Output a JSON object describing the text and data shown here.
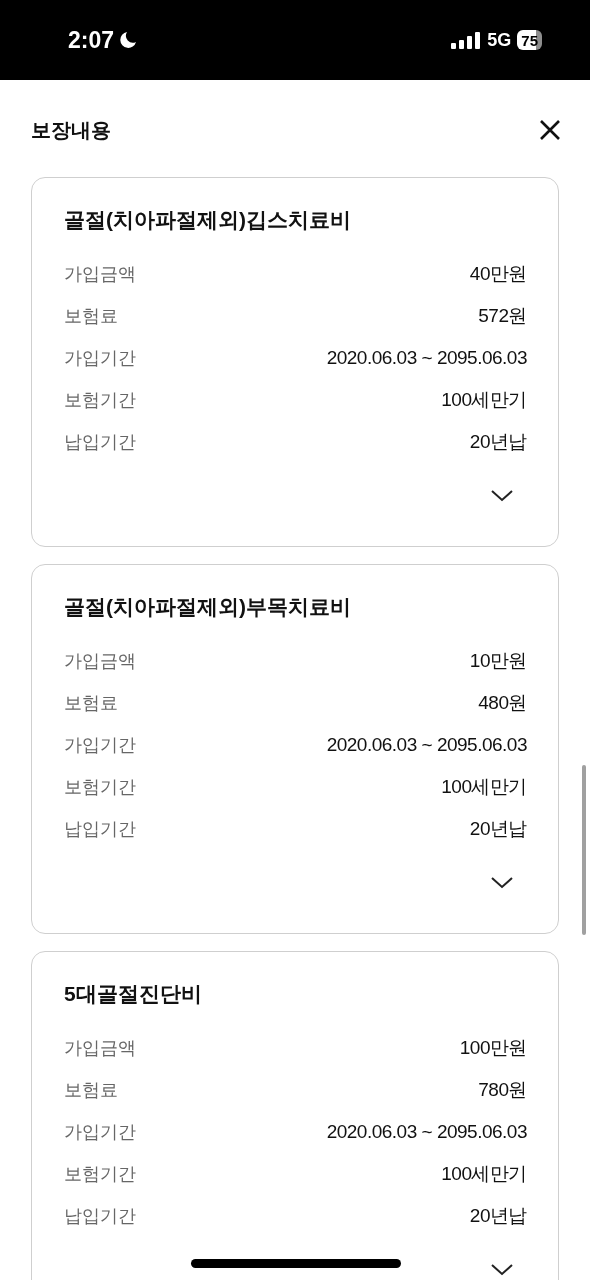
{
  "status_bar": {
    "time": "2:07",
    "network": "5G",
    "battery": "75"
  },
  "header": {
    "title": "보장내용"
  },
  "coverages": [
    {
      "title": "골절(치아파절제외)깁스치료비",
      "expanded": false,
      "rows": [
        {
          "label": "가입금액",
          "value": "40만원"
        },
        {
          "label": "보험료",
          "value": "572원"
        },
        {
          "label": "가입기간",
          "value": "2020.06.03 ~ 2095.06.03"
        },
        {
          "label": "보험기간",
          "value": "100세만기"
        },
        {
          "label": "납입기간",
          "value": "20년납"
        }
      ]
    },
    {
      "title": "골절(치아파절제외)부목치료비",
      "expanded": false,
      "rows": [
        {
          "label": "가입금액",
          "value": "10만원"
        },
        {
          "label": "보험료",
          "value": "480원"
        },
        {
          "label": "가입기간",
          "value": "2020.06.03 ~ 2095.06.03"
        },
        {
          "label": "보험기간",
          "value": "100세만기"
        },
        {
          "label": "납입기간",
          "value": "20년납"
        }
      ]
    },
    {
      "title": "5대골절진단비",
      "expanded": false,
      "rows": [
        {
          "label": "가입금액",
          "value": "100만원"
        },
        {
          "label": "보험료",
          "value": "780원"
        },
        {
          "label": "가입기간",
          "value": "2020.06.03 ~ 2095.06.03"
        },
        {
          "label": "보험기간",
          "value": "100세만기"
        },
        {
          "label": "납입기간",
          "value": "20년납"
        }
      ]
    }
  ]
}
